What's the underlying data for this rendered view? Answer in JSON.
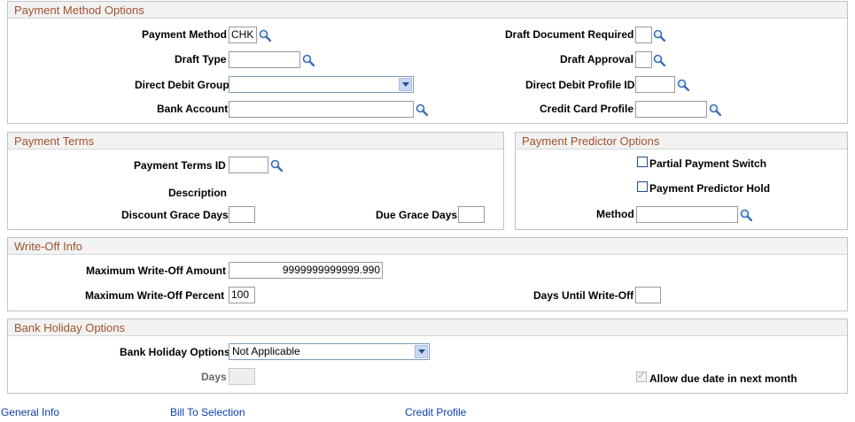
{
  "payment_method_options": {
    "title": "Payment Method Options",
    "payment_method_label": "Payment Method",
    "payment_method_value": "CHK",
    "draft_document_required_label": "Draft Document Required",
    "draft_type_label": "Draft Type",
    "draft_approval_label": "Draft Approval",
    "direct_debit_group_label": "Direct Debit Group",
    "direct_debit_group_value": "",
    "direct_debit_profile_id_label": "Direct Debit Profile ID",
    "bank_account_label": "Bank Account",
    "credit_card_profile_label": "Credit Card Profile"
  },
  "payment_terms": {
    "title": "Payment Terms",
    "payment_terms_id_label": "Payment Terms ID",
    "description_label": "Description",
    "discount_grace_days_label": "Discount Grace Days",
    "due_grace_days_label": "Due Grace Days"
  },
  "payment_predictor_options": {
    "title": "Payment Predictor Options",
    "partial_payment_switch_label": "Partial Payment Switch",
    "partial_payment_switch_checked": false,
    "payment_predictor_hold_label": "Payment Predictor Hold",
    "payment_predictor_hold_checked": false,
    "method_label": "Method"
  },
  "write_off_info": {
    "title": "Write-Off Info",
    "max_write_off_amount_label": "Maximum Write-Off Amount",
    "max_write_off_amount_value": "9999999999999.990",
    "max_write_off_percent_label": "Maximum Write-Off Percent",
    "max_write_off_percent_value": "100",
    "days_until_write_off_label": "Days Until Write-Off"
  },
  "bank_holiday_options": {
    "title": "Bank Holiday Options",
    "bank_holiday_options_label": "Bank Holiday Options",
    "bank_holiday_options_value": "Not Applicable",
    "days_label": "Days",
    "allow_due_date_label": "Allow due date in next month",
    "allow_due_date_checked": true
  },
  "footer_links": {
    "general_info": "General Info",
    "bill_to_selection": "Bill To Selection",
    "credit_profile": "Credit Profile"
  },
  "icons": {
    "lookup": "magnifier-icon",
    "dropdown": "chevron-down-icon"
  },
  "colors": {
    "group_title": "#a0522d",
    "link": "#0a3fa8"
  }
}
